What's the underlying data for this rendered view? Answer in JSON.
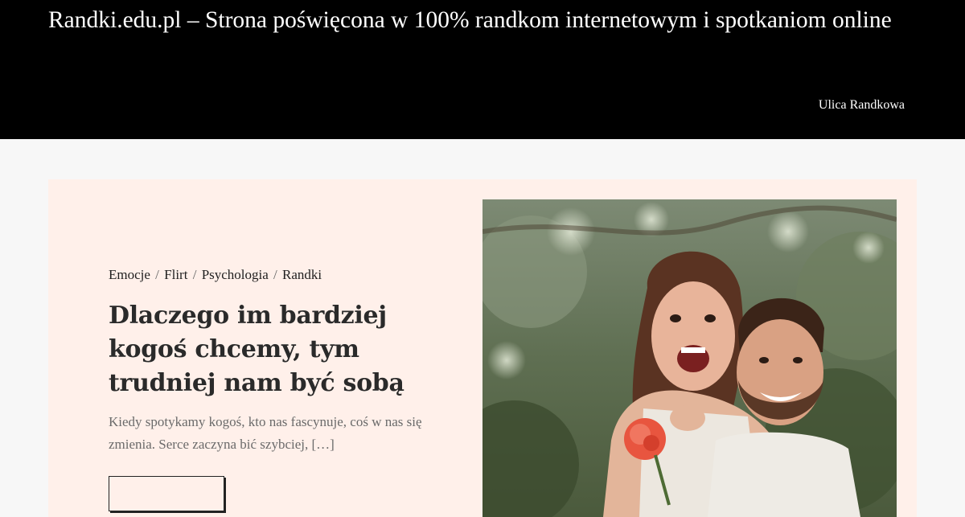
{
  "header": {
    "site_title": "Randki.edu.pl – Strona poświęcona w 100% randkom internetowym i spotkaniom online",
    "background": "#000000",
    "nav": [
      {
        "label": "Ulica Randkowa"
      }
    ]
  },
  "featured_post": {
    "categories": [
      "Emocje",
      "Flirt",
      "Psychologia",
      "Randki"
    ],
    "category_separator": "/",
    "title": "Dlaczego im bardziej kogoś chcemy, tym trudniej nam być sobą",
    "excerpt": "Kiedy spotykamy kogoś, kto nas fascynuje, coś w nas się zmienia. Serce zaczyna bić szybciej, […]",
    "image_description_icon": "couple-photo",
    "card_background": "#fff0ea"
  }
}
